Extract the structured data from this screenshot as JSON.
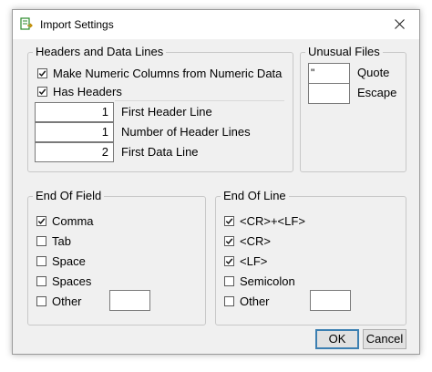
{
  "window": {
    "title": "Import Settings",
    "icon": "import-settings-app-icon",
    "close_icon": "close-icon"
  },
  "headers_group": {
    "legend": "Headers and Data Lines",
    "make_numeric": {
      "label": "Make Numeric Columns from Numeric Data",
      "checked": true
    },
    "has_headers": {
      "label": "Has Headers",
      "checked": true
    },
    "first_header_line": {
      "value": "1",
      "label": "First Header Line"
    },
    "number_header_lines": {
      "value": "1",
      "label": "Number of Header Lines"
    },
    "first_data_line": {
      "value": "2",
      "label": "First Data Line"
    }
  },
  "unusual_files": {
    "legend": "Unusual Files",
    "quote": {
      "value": "\"",
      "label": "Quote"
    },
    "escape": {
      "value": "",
      "label": "Escape"
    }
  },
  "end_of_field": {
    "legend": "End Of Field",
    "items": [
      {
        "label": "Comma",
        "checked": true
      },
      {
        "label": "Tab",
        "checked": false
      },
      {
        "label": "Space",
        "checked": false
      },
      {
        "label": "Spaces",
        "checked": false
      },
      {
        "label": "Other",
        "checked": false
      }
    ],
    "other_value": ""
  },
  "end_of_line": {
    "legend": "End Of Line",
    "items": [
      {
        "label": "<CR>+<LF>",
        "checked": true
      },
      {
        "label": "<CR>",
        "checked": true
      },
      {
        "label": "<LF>",
        "checked": true
      },
      {
        "label": "Semicolon",
        "checked": false
      },
      {
        "label": "Other",
        "checked": false
      }
    ],
    "other_value": ""
  },
  "buttons": {
    "ok": "OK",
    "cancel": "Cancel"
  }
}
